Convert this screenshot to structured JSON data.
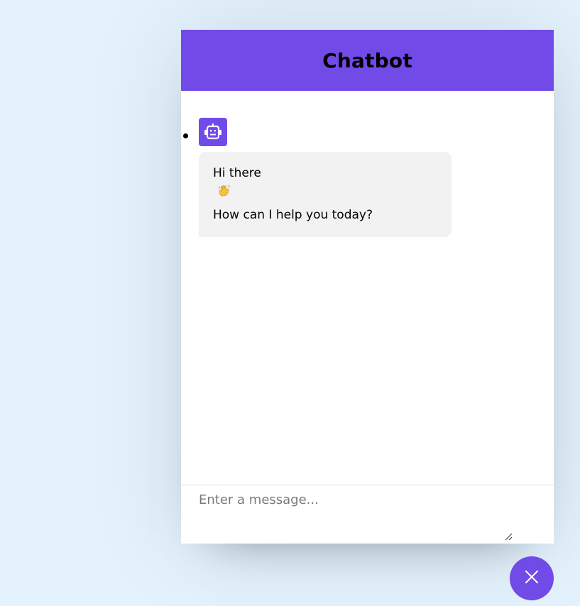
{
  "header": {
    "title": "Chatbot"
  },
  "messages": [
    {
      "from": "bot",
      "avatar_icon": "robot-face-icon",
      "lines": [
        "Hi there",
        "How can I help you today?"
      ],
      "emoji_icon": "waving-hand-icon"
    }
  ],
  "input": {
    "placeholder": "Enter a message..."
  },
  "toggler": {
    "icon": "close-icon"
  },
  "colors": {
    "accent": "#724ae8",
    "page_background": "#e3f2fd",
    "bubble_background": "#f2f2f2"
  }
}
